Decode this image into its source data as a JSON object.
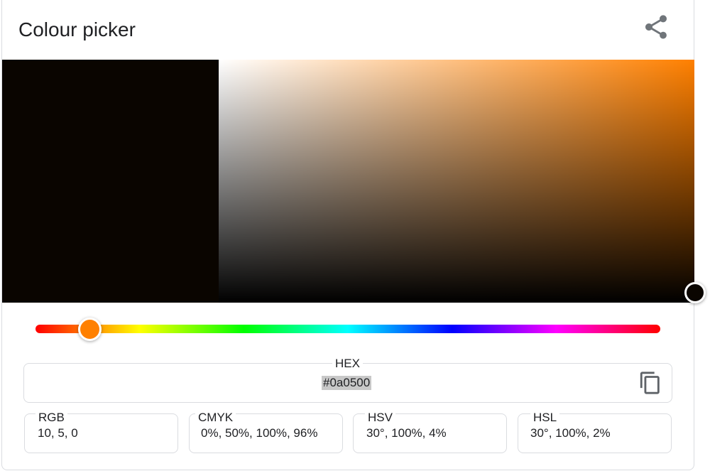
{
  "title": "Colour picker",
  "icons": {
    "share": "share-icon",
    "copy": "copy-icon"
  },
  "colors": {
    "selected": "#0a0500",
    "hue": "#ff8000",
    "border": "#dadce0",
    "text": "#202124"
  },
  "picker": {
    "hue_degrees": 30,
    "saturation_percent": 100,
    "value_percent": 4
  },
  "hex": {
    "label": "HEX",
    "value": "#0a0500"
  },
  "formats": [
    {
      "label": "RGB",
      "value": "10, 5, 0"
    },
    {
      "label": "CMYK",
      "value": "0%, 50%, 100%, 96%"
    },
    {
      "label": "HSV",
      "value": "30°, 100%, 4%"
    },
    {
      "label": "HSL",
      "value": "30°, 100%, 2%"
    }
  ]
}
